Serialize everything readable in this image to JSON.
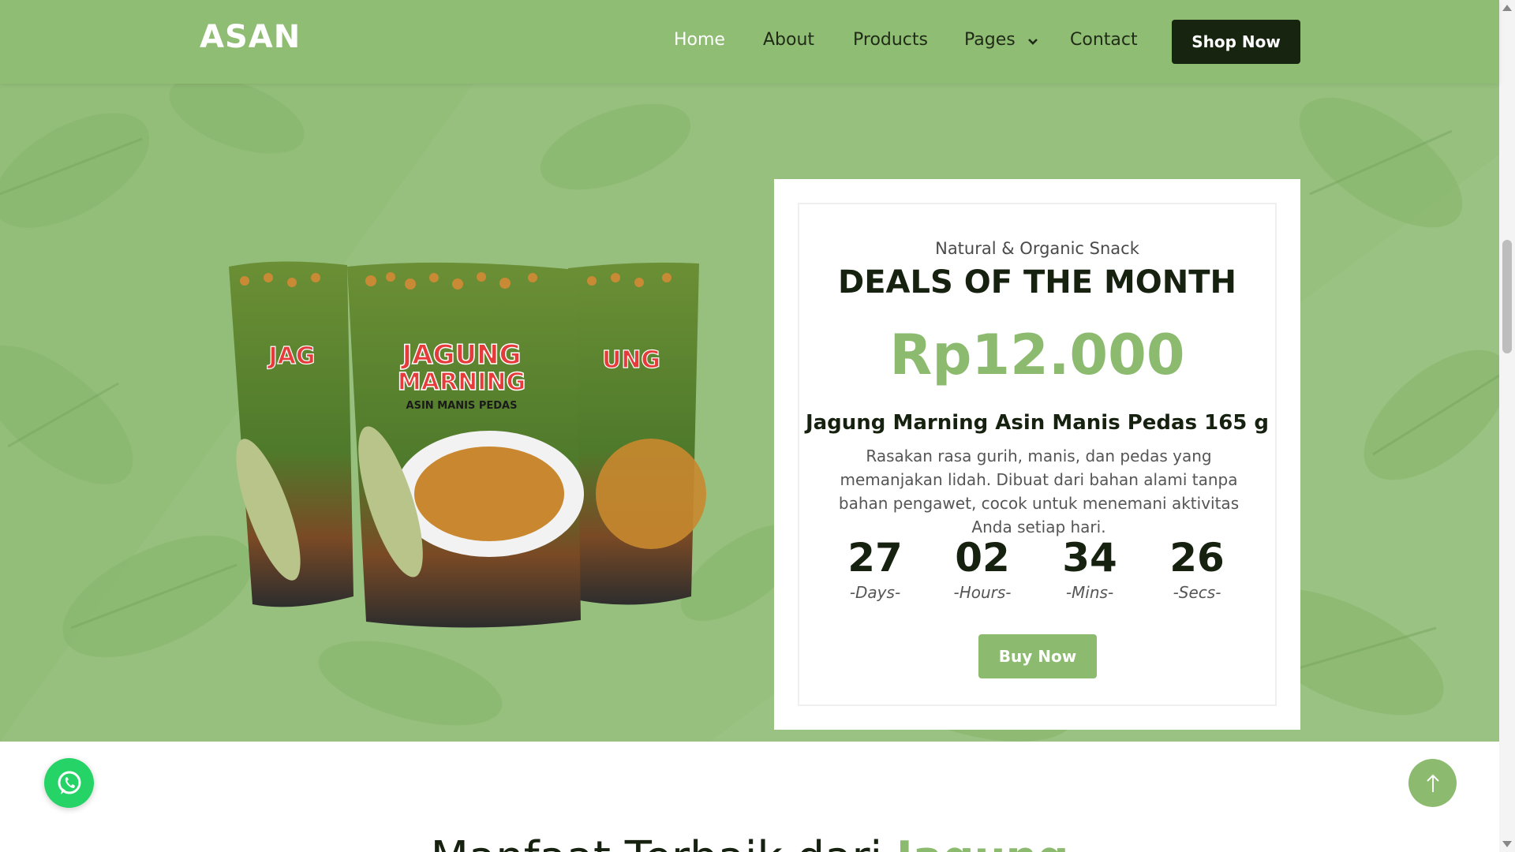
{
  "nav": {
    "brand": "ASAN",
    "items": [
      {
        "label": "Home",
        "active": true
      },
      {
        "label": "About"
      },
      {
        "label": "Products"
      },
      {
        "label": "Pages",
        "has_dropdown": true
      },
      {
        "label": "Contact"
      }
    ],
    "cta": "Shop Now"
  },
  "deal": {
    "subtitle": "Natural & Organic Snack",
    "title": "DEALS OF THE MONTH",
    "price": "Rp12.000",
    "product_name": "Jagung Marning Asin Manis Pedas 165 g",
    "description": "Rasakan rasa gurih, manis, dan pedas yang memanjakan lidah. Dibuat dari bahan alami tanpa bahan pengawet, cocok untuk menemani aktivitas Anda setiap hari.",
    "countdown": [
      {
        "value": "27",
        "label": "-Days-"
      },
      {
        "value": "02",
        "label": "-Hours-"
      },
      {
        "value": "34",
        "label": "-Mins-"
      },
      {
        "value": "26",
        "label": "-Secs-"
      }
    ],
    "buy_label": "Buy Now"
  },
  "product_image": {
    "brand_on_pack": "JAGUNG MARNING",
    "pack_subtitle": "ASIN MANIS PEDAS",
    "weight": "165g"
  },
  "section": {
    "heading_prefix": "Manfaat Terbaik dari",
    "heading_highlight": "Jagung"
  },
  "floating": {
    "whatsapp_icon": "whatsapp-icon",
    "back_to_top_icon": "arrow-up-icon"
  },
  "colors": {
    "primary_green": "#8cbb70",
    "navbar_green": "#90bd74",
    "dark": "#172410",
    "whatsapp": "#25d366"
  }
}
